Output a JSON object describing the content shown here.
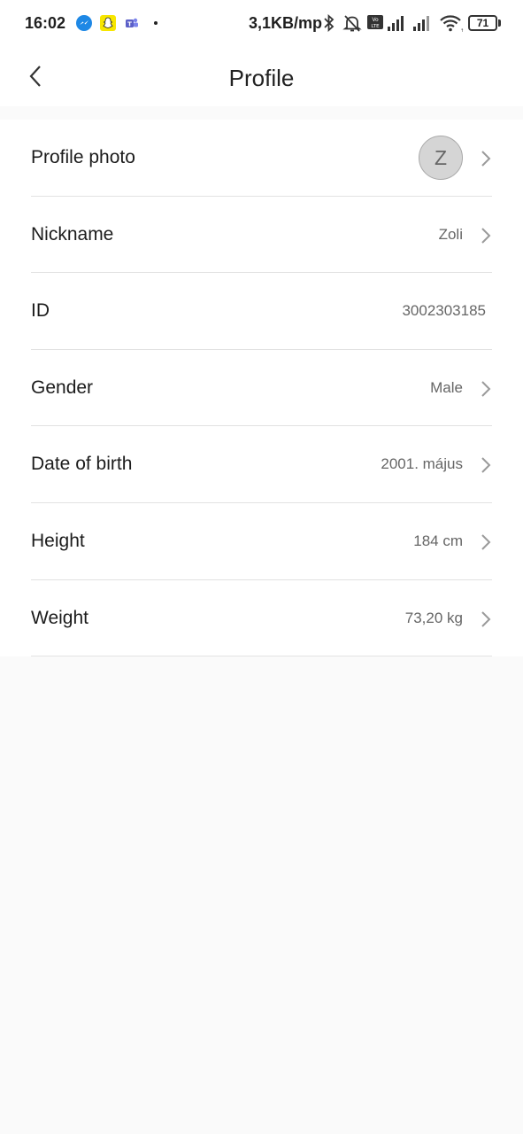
{
  "status_bar": {
    "time": "16:02",
    "network_speed": "3,1KB/mp",
    "battery": "71",
    "icons": [
      "messenger-icon",
      "snapchat-icon",
      "teams-icon",
      "bluetooth-icon",
      "notifications-off-icon",
      "volte-icon",
      "signal-icon",
      "wifi-icon",
      "battery-icon"
    ]
  },
  "header": {
    "title": "Profile",
    "back_icon": "chevron-left-icon"
  },
  "rows": [
    {
      "label": "Profile photo",
      "avatar_initial": "Z"
    },
    {
      "label": "Nickname",
      "value": "Zoli"
    },
    {
      "label": "ID",
      "value": "3002303185"
    },
    {
      "label": "Gender",
      "value": "Male"
    },
    {
      "label": "Date of birth",
      "value": "2001. május"
    },
    {
      "label": "Height",
      "value": "184 cm"
    },
    {
      "label": "Weight",
      "value": "73,20 kg"
    }
  ]
}
